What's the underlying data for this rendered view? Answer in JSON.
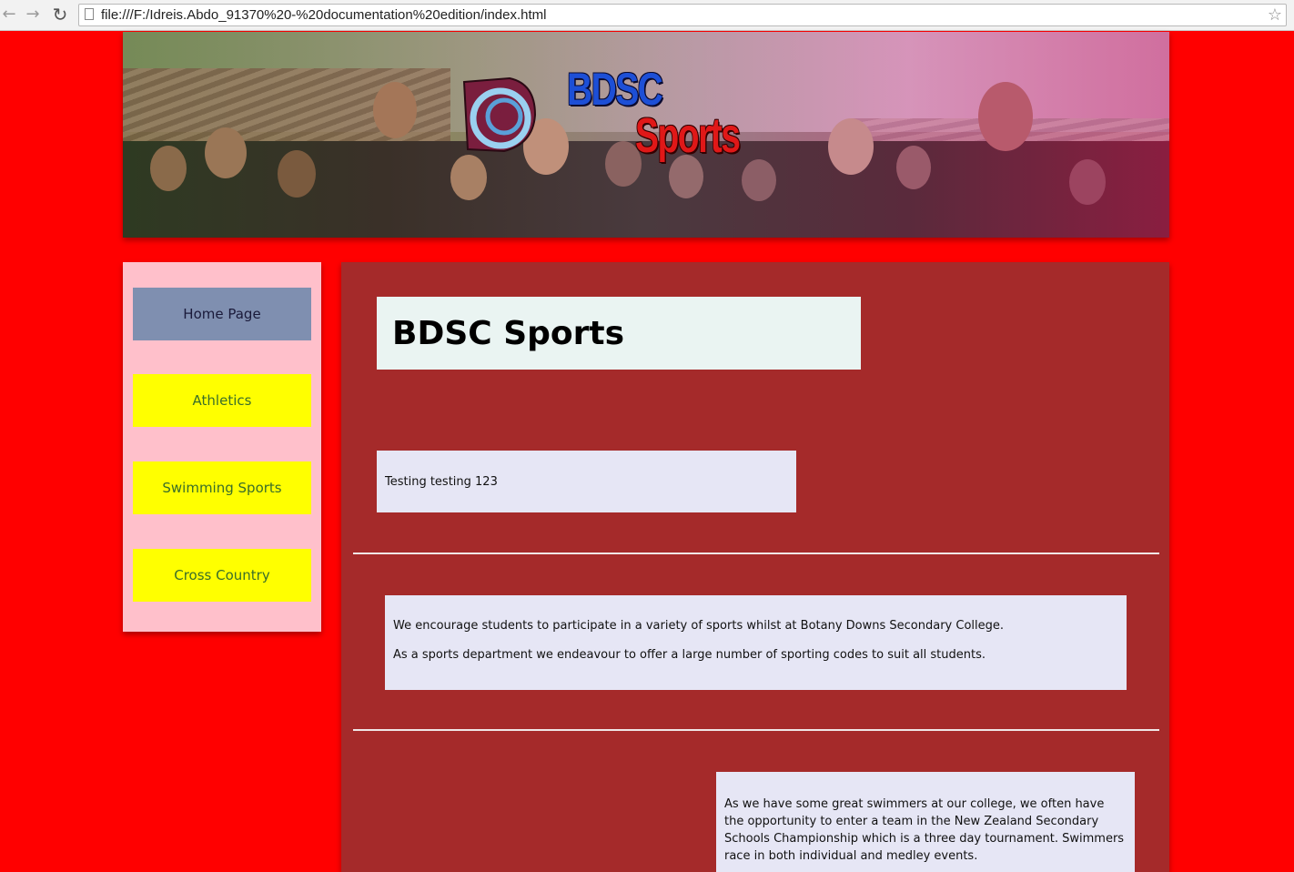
{
  "browser": {
    "url": "file:///F:/Idreis.Abdo_91370%20-%20documentation%20edition/index.html",
    "back_icon": "back-arrow-icon",
    "forward_icon": "forward-arrow-icon",
    "reload_icon": "reload-icon",
    "bookmark_icon": "star-icon"
  },
  "banner": {
    "logo_line1": "BDSC",
    "logo_line2": "Sports"
  },
  "sidebar": {
    "items": [
      {
        "label": "Home Page",
        "active": true
      },
      {
        "label": "Athletics",
        "active": false
      },
      {
        "label": "Swimming Sports",
        "active": false
      },
      {
        "label": "Cross Country",
        "active": false
      }
    ]
  },
  "main": {
    "title": "BDSC Sports",
    "testing_text": "Testing testing 123",
    "intro_p1": "We encourage students to participate in a variety of sports whilst at Botany Downs Secondary College.",
    "intro_p2": "As a sports department we endeavour to offer a large number of sporting codes to suit all students.",
    "swimming_text": "As we have some great swimmers at our college, we often have the opportunity to enter a team in the New Zealand Secondary Schools Championship which is a three day tournament. Swimmers race in both individual and medley events."
  },
  "colors": {
    "page_background": "#ff0000",
    "sidebar_background": "#ffc0cb",
    "nav_button": "#ffff00",
    "nav_button_active": "#7f8fb0",
    "main_background": "#a52a2a",
    "text_box": "#e6e6f5"
  }
}
